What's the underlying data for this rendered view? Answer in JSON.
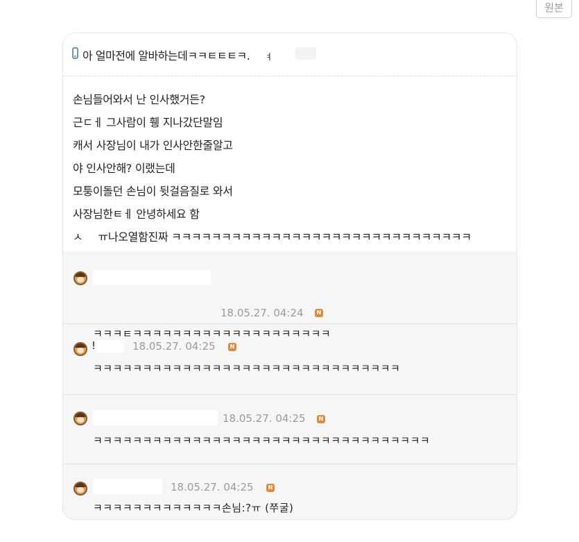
{
  "button": {
    "label": "원본"
  },
  "post": {
    "title": "아 얼마전에 알바하는데ㅋㅋㅌㅌㅌㅋ.",
    "title_tail": "ㅕ",
    "lines": [
      "손님들어와서 난 인사했거든?",
      "근ㄷㅔ 그사람이 휑 지나갔단말임",
      "캐서 사장님이 내가 인사안한줄알고",
      "야 인사안해? 이랬는데",
      "모퉁이돌던 손님이 뒷걸음질로 와서",
      "사장님한ㅌㅔ 안녕하세요 함",
      "ㅠ나오열함진짜 ㅋㅋㅋㅋㅋㅋㅋㅋㅋㅋㅋㅋㅋㅋㅋㅋㅋㅋㅋㅋㅋㅋㅋㅋㅋㅋㅋㅋㅋㅋ"
    ],
    "last_line_prefix": "ㅅ"
  },
  "comments": [
    {
      "name_partial": "",
      "timestamp": "18.05.27. 04:24",
      "badge": "N",
      "text": "ㅋㅋㅋㅌㅋㅋㅋㅋㅋㅋㅋㅋㅋㅋㅋㅋㅋㅋㅋㅋㅋㅋㅋㅋ"
    },
    {
      "name_partial": "!",
      "timestamp": "18.05.27. 04:25",
      "badge": "N",
      "text": "ㅋㅋㅋㅋㅋㅋㅋㅋㅋㅋㅋㅋㅋㅋㅋㅋㅋㅋㅋㅋㅋㅋㅋㅋㅋㅋㅋㅋㅋㅋㅋ"
    },
    {
      "name_partial": "",
      "timestamp": "18.05.27. 04:25",
      "badge": "N",
      "text": "ㅋㅋㅋㅋㅋㅋㅋㅋㅋㅋㅋㅋㅋㅋㅋㅋㅋㅋㅋㅋㅋㅋㅋㅋㅋㅋㅋㅋㅋㅋㅋㅋㅋㅋ"
    },
    {
      "name_partial": "",
      "timestamp": "18.05.27. 04:25",
      "badge": "N",
      "text": "ㅋㅋㅋㅋㅋㅋㅋㅋㅋㅋㅋㅋㅋ손님:?ㅠ (쭈굴)"
    }
  ],
  "colors": {
    "badge": "#e08a3c",
    "timestamp": "#9b9b9b",
    "phone_icon": "#6f8fc8"
  },
  "icons": {
    "title": "phone-icon",
    "commenter": "avatar-icon"
  }
}
